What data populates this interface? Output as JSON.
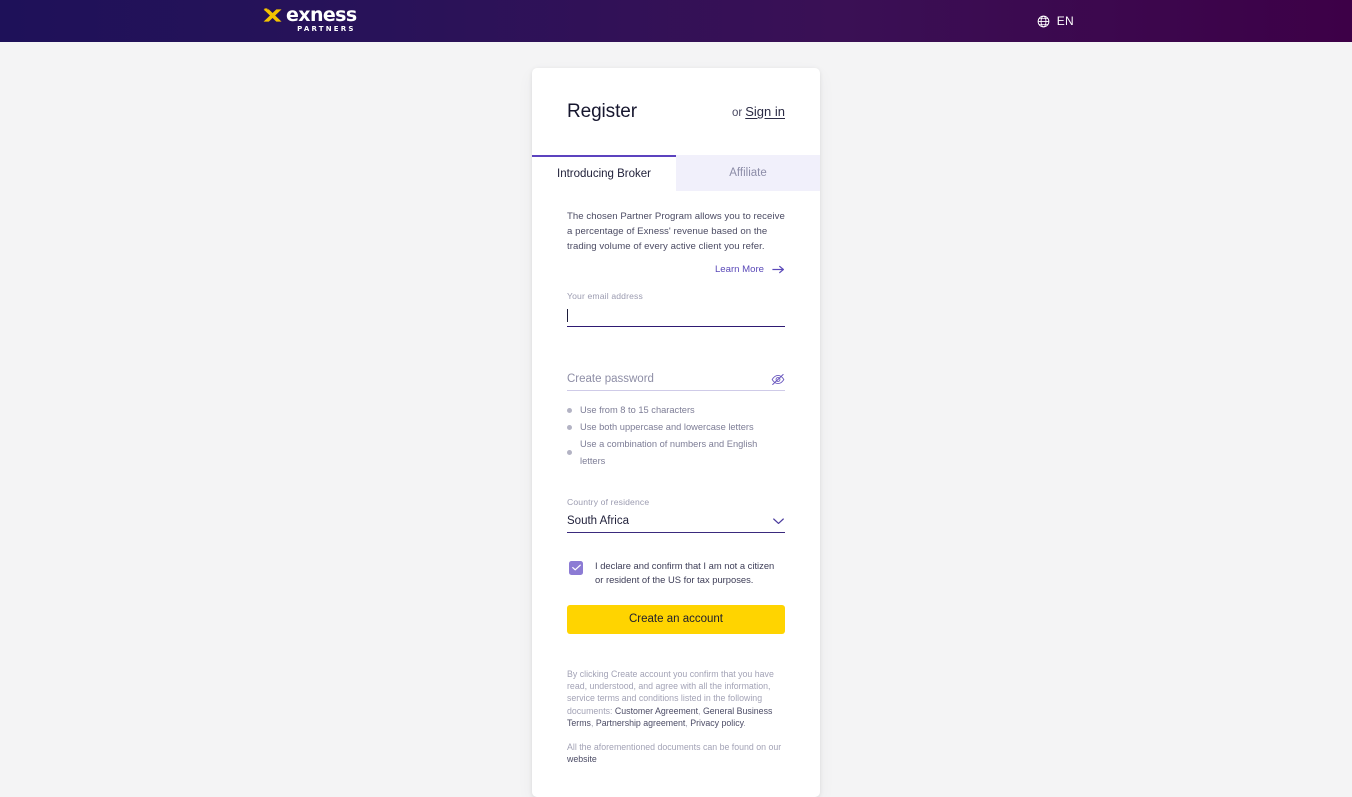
{
  "header": {
    "logo_word": "exness",
    "logo_sub": "PARTNERS",
    "logo_mark_icon": "exness-x-mark-icon",
    "language": {
      "icon": "globe-icon",
      "label": "EN"
    },
    "gradient_from": "#1e1159",
    "gradient_to": "#3d0047"
  },
  "card": {
    "title": "Register",
    "signin_prefix": "or",
    "signin_label": "Sign in",
    "tabs": [
      {
        "label": "Introducing Broker",
        "active": true
      },
      {
        "label": "Affiliate",
        "active": false
      }
    ],
    "description": "The chosen Partner Program allows you to receive a percentage of Exness' revenue based on the trading volume of every active client you refer.",
    "learn_more": {
      "label": "Learn More",
      "icon": "arrow-right-icon"
    },
    "email": {
      "label": "Your email address",
      "value": "",
      "placeholder": "",
      "focused": true
    },
    "password": {
      "placeholder": "Create password",
      "value": "",
      "toggle_icon": "eye-off-icon",
      "rules": [
        "Use from 8 to 15 characters",
        "Use both uppercase and lowercase letters",
        "Use a combination of numbers and English letters"
      ]
    },
    "country": {
      "label": "Country of residence",
      "value": "South Africa",
      "icon": "chevron-down-icon"
    },
    "declaration": {
      "checked": true,
      "check_icon": "check-icon",
      "text": "I declare and confirm that I am not a citizen or resident of the US for tax purposes."
    },
    "submit_label": "Create an account",
    "legal": {
      "intro": "By clicking Create account you confirm that you have read, understood, and agree with all the information, service terms and conditions listed in the following documents: ",
      "links": [
        "Customer Agreement",
        "General Business Terms",
        "Partnership agreement",
        "Privacy policy"
      ],
      "separator": ", ",
      "terminator": ".",
      "footer_text": "All the aforementioned documents can be found on our ",
      "footer_link": "website"
    }
  },
  "colors": {
    "accent_purple": "#5c43bf",
    "brand_yellow": "#ffd400",
    "page_bg": "#f4f4f5"
  }
}
